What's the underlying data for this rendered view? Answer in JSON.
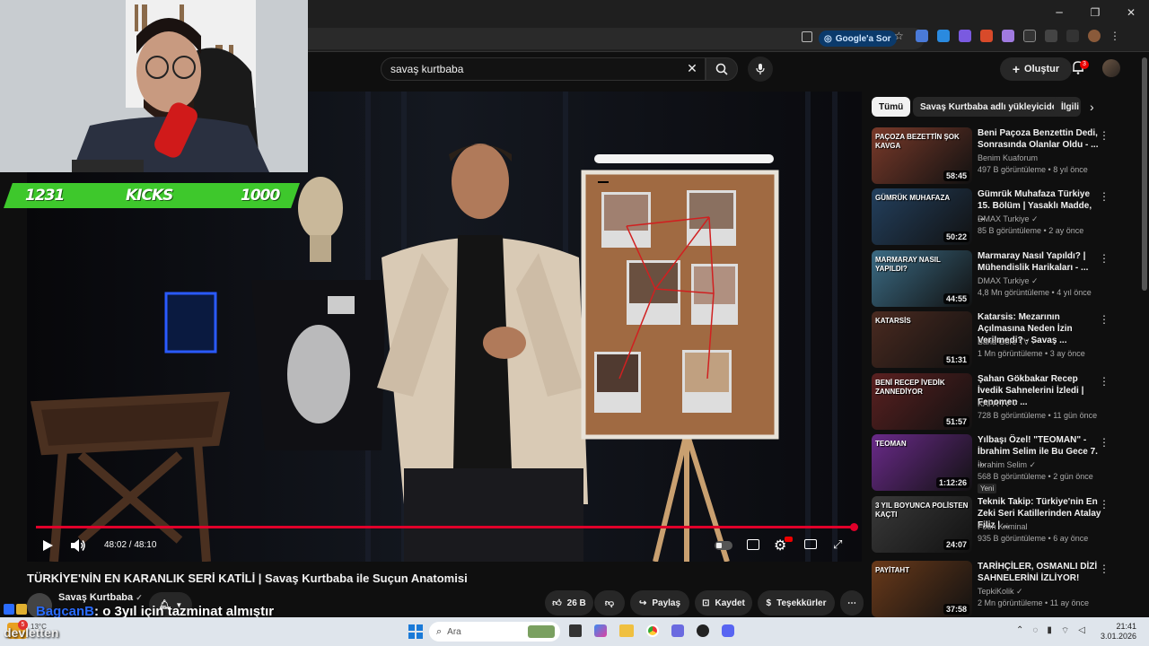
{
  "browser": {
    "google_sor": "Google'a Sor"
  },
  "youtube": {
    "search_value": "savaş kurtbaba",
    "create_label": "Oluştur",
    "notification_count": "3"
  },
  "overlay": {
    "kicks_left": "1231",
    "kicks_label": "KICKS",
    "kicks_right": "1000",
    "chat_user": "BagcanB",
    "chat_text": ": o 3yıl için tazminat almıştır",
    "streamer_label": "devletten"
  },
  "player": {
    "time": "48:02 / 48:10",
    "progress": 0.997
  },
  "video": {
    "title": "TÜRKİYE'NİN EN KARANLIK SERİ KATİLİ | Savaş Kurtbaba ile Suçun Anatomisi",
    "channel": "Savaş Kurtbaba",
    "likes": "26 B",
    "share": "Paylaş",
    "save": "Kaydet",
    "thanks": "Teşekkürler"
  },
  "chips": [
    "Tümü",
    "Savaş Kurtbaba adlı yükleyiciden",
    "İlgili"
  ],
  "recommendations": [
    {
      "title": "Beni Paçoza Benzettin Dedi, Sonrasında Olanlar Oldu - ...",
      "channel": "Benim Kuaforum",
      "meta": "497 B görüntüleme • 8 yıl önce",
      "duration": "58:45",
      "color": "#7a3a2a",
      "overlay": "PAÇOZA BEZETTİN ŞOK KAVGA"
    },
    {
      "title": "Gümrük Muhafaza Türkiye 15. Bölüm | Yasaklı Madde, ...",
      "channel": "DMAX Turkiye ✓",
      "meta": "85 B görüntüleme • 2 ay önce",
      "duration": "50:22",
      "color": "#23405e",
      "overlay": "GÜMRÜK MUHAFAZA"
    },
    {
      "title": "Marmaray Nasıl Yapıldı? | Mühendislik Harikaları - ...",
      "channel": "DMAX Turkiye ✓",
      "meta": "4,8 Mn görüntüleme • 4 yıl önce",
      "duration": "44:55",
      "color": "#3b6b84",
      "overlay": "MARMARAY NASIL YAPILDI?"
    },
    {
      "title": "Katarsis: Mezarının Açılmasına Neden İzin Verilmedi? - Savaş ...",
      "channel": "Bana Göre TV ✓",
      "meta": "1 Mn görüntüleme • 3 ay önce",
      "duration": "51:31",
      "color": "#4a2a20",
      "overlay": "KATARSİS"
    },
    {
      "title": "Şahan Gökbakar Recep İvedik Sahnelerini İzledi | Fenomen ...",
      "channel": "KAFA TV ✓",
      "meta": "728 B görüntüleme • 11 gün önce",
      "duration": "51:57",
      "color": "#5a2020",
      "overlay": "BENİ RECEP İVEDİK ZANNEDİYOR"
    },
    {
      "title": "Yılbaşı Özel! \"TEOMAN\" - İbrahim Selim ile Bu Gece 7. ...",
      "channel": "İbrahim Selim ✓",
      "meta": "568 B görüntüleme • 2 gün önce",
      "duration": "1:12:26",
      "color": "#6a2a8a",
      "overlay": "TEOMAN",
      "new": "Yeni"
    },
    {
      "title": "Teknik Takip: Türkiye'nin En Zeki Seri Katillerinden Atalay Filiz | ...",
      "channel": "Foon Kriminal",
      "meta": "935 B görüntüleme • 6 ay önce",
      "duration": "24:07",
      "color": "#3a3a3a",
      "overlay": "3 YIL BOYUNCA POLİSTEN KAÇTI"
    },
    {
      "title": "TARİHÇİLER, OSMANLI DİZİ SAHNELERİNİ İZLİYOR!",
      "channel": "TepkiKolik ✓",
      "meta": "2 Mn görüntüleme • 11 ay önce",
      "duration": "37:58",
      "color": "#6a3a1a",
      "overlay": "PAYİTAHT"
    }
  ],
  "taskbar": {
    "search_placeholder": "Ara",
    "weather": "13°C",
    "time": "21:41",
    "date": "3.01.2026"
  }
}
